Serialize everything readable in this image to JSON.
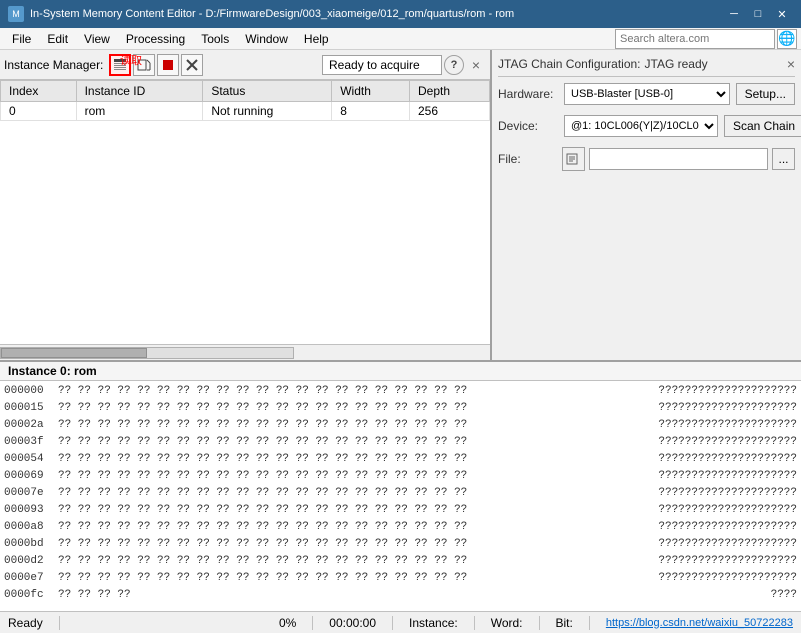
{
  "titlebar": {
    "title": "In-System Memory Content Editor - D:/FirmwareDesign/003_xiaomeige/012_rom/quartus/rom - rom",
    "controls": [
      "minimize",
      "maximize",
      "close"
    ]
  },
  "menubar": {
    "items": [
      "File",
      "Edit",
      "View",
      "Processing",
      "Tools",
      "Window",
      "Help"
    ]
  },
  "chinese_label": "读取",
  "toolbar": {
    "label": "Instance Manager:",
    "status": "Ready to acquire",
    "help_label": "?",
    "close_label": "×"
  },
  "table": {
    "columns": [
      "Index",
      "Instance ID",
      "Status",
      "Width",
      "Depth"
    ],
    "rows": [
      {
        "index": "0",
        "instance_id": "rom",
        "status": "Not running",
        "width": "8",
        "depth": "256"
      }
    ]
  },
  "jtag": {
    "title": "JTAG Chain Configuration:",
    "status": "JTAG ready",
    "close_label": "×",
    "hardware_label": "Hardware:",
    "hardware_value": "USB-Blaster [USB-0]",
    "setup_label": "Setup...",
    "device_label": "Device:",
    "device_value": "@1: 10CL006(Y|Z)/10CL0",
    "scan_chain_label": "Scan Chain",
    "file_label": "File:",
    "file_dots": "..."
  },
  "hex_viewer": {
    "header": "Instance 0: rom",
    "rows": [
      {
        "addr": "000000",
        "bytes": "?? ?? ?? ?? ?? ?? ?? ?? ?? ?? ?? ?? ?? ?? ?? ?? ?? ?? ?? ?? ??",
        "ascii": "?????????????????????"
      },
      {
        "addr": "000015",
        "bytes": "?? ?? ?? ?? ?? ?? ?? ?? ?? ?? ?? ?? ?? ?? ?? ?? ?? ?? ?? ?? ??",
        "ascii": "?????????????????????"
      },
      {
        "addr": "00002a",
        "bytes": "?? ?? ?? ?? ?? ?? ?? ?? ?? ?? ?? ?? ?? ?? ?? ?? ?? ?? ?? ?? ??",
        "ascii": "?????????????????????"
      },
      {
        "addr": "00003f",
        "bytes": "?? ?? ?? ?? ?? ?? ?? ?? ?? ?? ?? ?? ?? ?? ?? ?? ?? ?? ?? ?? ??",
        "ascii": "?????????????????????"
      },
      {
        "addr": "000054",
        "bytes": "?? ?? ?? ?? ?? ?? ?? ?? ?? ?? ?? ?? ?? ?? ?? ?? ?? ?? ?? ?? ??",
        "ascii": "?????????????????????"
      },
      {
        "addr": "000069",
        "bytes": "?? ?? ?? ?? ?? ?? ?? ?? ?? ?? ?? ?? ?? ?? ?? ?? ?? ?? ?? ?? ??",
        "ascii": "?????????????????????"
      },
      {
        "addr": "00007e",
        "bytes": "?? ?? ?? ?? ?? ?? ?? ?? ?? ?? ?? ?? ?? ?? ?? ?? ?? ?? ?? ?? ??",
        "ascii": "?????????????????????"
      },
      {
        "addr": "000093",
        "bytes": "?? ?? ?? ?? ?? ?? ?? ?? ?? ?? ?? ?? ?? ?? ?? ?? ?? ?? ?? ?? ??",
        "ascii": "?????????????????????"
      },
      {
        "addr": "0000a8",
        "bytes": "?? ?? ?? ?? ?? ?? ?? ?? ?? ?? ?? ?? ?? ?? ?? ?? ?? ?? ?? ?? ??",
        "ascii": "?????????????????????"
      },
      {
        "addr": "0000bd",
        "bytes": "?? ?? ?? ?? ?? ?? ?? ?? ?? ?? ?? ?? ?? ?? ?? ?? ?? ?? ?? ?? ??",
        "ascii": "?????????????????????"
      },
      {
        "addr": "0000d2",
        "bytes": "?? ?? ?? ?? ?? ?? ?? ?? ?? ?? ?? ?? ?? ?? ?? ?? ?? ?? ?? ?? ??",
        "ascii": "?????????????????????"
      },
      {
        "addr": "0000e7",
        "bytes": "?? ?? ?? ?? ?? ?? ?? ?? ?? ?? ?? ?? ?? ?? ?? ?? ?? ?? ?? ?? ??",
        "ascii": "?????????????????????"
      },
      {
        "addr": "0000fc",
        "bytes": "?? ?? ?? ??",
        "ascii": "????"
      }
    ]
  },
  "statusbar": {
    "ready": "Ready",
    "progress": "0%",
    "time": "00:00:00",
    "instance_label": "Instance:",
    "word_label": "Word:",
    "bit_label": "Bit:",
    "link_text": "https://blog.csdn.net/waixiu_50722283"
  },
  "search": {
    "placeholder": "Search altera.com"
  }
}
